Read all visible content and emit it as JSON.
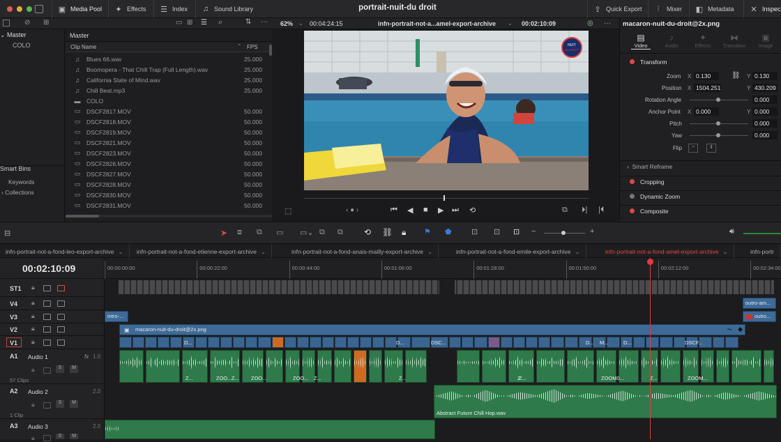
{
  "top_nav": {
    "media_pool": "Media Pool",
    "effects": "Effects",
    "index": "Index",
    "sound_library": "Sound Library",
    "project_title": "portrait-nuit-du droit",
    "quick_export": "Quick Export",
    "mixer": "Mixer",
    "metadata": "Metadata",
    "inspector": "Inspect"
  },
  "bins": {
    "root": "Master",
    "sub": "COLO",
    "smart_bins": "Smart Bins",
    "keywords": "Keywords",
    "collections": "Collections"
  },
  "clip_list": {
    "header": "Master",
    "col_name": "Clip Name",
    "col_fps": "FPS",
    "rows": [
      {
        "icon": "audio-icon",
        "name": "Blues 66.wav",
        "fps": "25.000"
      },
      {
        "icon": "audio-icon",
        "name": "Boomopera - That Chill Trap (Full Length).wav",
        "fps": "25.000"
      },
      {
        "icon": "audio-icon",
        "name": "California State of Mind.wav",
        "fps": "25.000"
      },
      {
        "icon": "audio-icon",
        "name": "Chill Beat.mp3",
        "fps": "25.000"
      },
      {
        "icon": "folder-icon",
        "name": "COLO",
        "fps": ""
      },
      {
        "icon": "video-icon",
        "name": "DSCF2817.MOV",
        "fps": "50.000"
      },
      {
        "icon": "video-icon",
        "name": "DSCF2818.MOV",
        "fps": "50.000"
      },
      {
        "icon": "video-icon",
        "name": "DSCF2819.MOV",
        "fps": "50.000"
      },
      {
        "icon": "video-icon",
        "name": "DSCF2821.MOV",
        "fps": "50.000"
      },
      {
        "icon": "video-icon",
        "name": "DSCF2823.MOV",
        "fps": "50.000"
      },
      {
        "icon": "video-icon",
        "name": "DSCF2826.MOV",
        "fps": "50.000"
      },
      {
        "icon": "video-icon",
        "name": "DSCF2827.MOV",
        "fps": "50.000"
      },
      {
        "icon": "video-icon",
        "name": "DSCF2828.MOV",
        "fps": "50.000"
      },
      {
        "icon": "video-icon",
        "name": "DSCF2830.MOV",
        "fps": "50.000"
      },
      {
        "icon": "video-icon",
        "name": "DSCF2831.MOV",
        "fps": "50.000"
      }
    ]
  },
  "viewer": {
    "zoom": "62%",
    "source_tc": "00:04:24:15",
    "timeline_name": "infn-portrait-not-a...amel-export-archive",
    "record_tc": "00:02:10:09",
    "logo_text": "NUIT DU DROIT"
  },
  "inspector": {
    "file_name": "macaron-nuit-du-droit@2x.png",
    "tabs": [
      "Video",
      "Audio",
      "Effects",
      "Transition",
      "Image"
    ],
    "transform": "Transform",
    "zoom_label": "Zoom",
    "zoom_x": "0.130",
    "zoom_y": "0.130",
    "position_label": "Position",
    "position_x": "1504.251",
    "position_y": "430.209",
    "rotation_label": "Rotation Angle",
    "rotation_val": "0.000",
    "anchor_label": "Anchor Point",
    "anchor_x": "0.000",
    "anchor_y": "0.000",
    "pitch_label": "Pitch",
    "pitch_val": "0.000",
    "yaw_label": "Yaw",
    "yaw_val": "0.000",
    "flip_label": "Flip",
    "smart_reframe": "Smart Reframe",
    "cropping": "Cropping",
    "dynamic_zoom": "Dynamic Zoom",
    "composite": "Composite",
    "x": "X",
    "y": "Y"
  },
  "timeline_tabs": [
    {
      "label": "infn-portrait-not-a-fond-leo-export-archive",
      "active": false
    },
    {
      "label": "infn-portrait-not-a-fond-etienne-export-archive",
      "active": false
    },
    {
      "label": "infn-portrait-not-a-fond-anais-mailly-export-archive",
      "active": false
    },
    {
      "label": "infn-portrait-not-a-fond-emile-export-archive",
      "active": false
    },
    {
      "label": "infn-portrait-not-a-fond-amel-export-archive",
      "active": true
    },
    {
      "label": "infn-portr",
      "active": false
    }
  ],
  "timeline": {
    "timecode": "00:02:10:09",
    "ruler": [
      "00:00:00:00",
      "00:00:22:00",
      "00:00:44:00",
      "00:01:06:00",
      "00:01:28:00",
      "00:01:50:00",
      "00:02:12:00",
      "00:02:34:00"
    ],
    "tracks": {
      "st1": "ST1",
      "v4": "V4",
      "v3": "V3",
      "v2": "V2",
      "v1": "V1",
      "a1": "A1",
      "a1_name": "Audio 1",
      "a1_fx": "fx",
      "a1_level": "1.0",
      "a1_clips": "57 Clips",
      "a2": "A2",
      "a2_name": "Audio 2",
      "a2_level": "2.0",
      "a2_clips": "1 Clip",
      "a3": "A3",
      "a3_name": "Audio 3",
      "a3_level": "2.0",
      "solo": "S",
      "mute": "M"
    },
    "clips": {
      "v3_intro": "intro-...",
      "v4_outro": "outro-am...",
      "v3_outro": "outro...",
      "v2_macaron": "macaron-nuit-du-droit@2x.png",
      "v1_labels": [
        "D...",
        "D...",
        "DSC...",
        "D...",
        "M...",
        "D...",
        "DSCF..."
      ],
      "a1_labels": [
        "Z...",
        "ZOO...",
        "Z...",
        "ZOO...",
        "ZOO...",
        "Z...",
        "Z...",
        "Z...",
        "Z...",
        "ZOOM0...",
        "Z...",
        "ZOOM..."
      ],
      "a2_music": "Abstract Future Chill Hop.wav"
    }
  }
}
